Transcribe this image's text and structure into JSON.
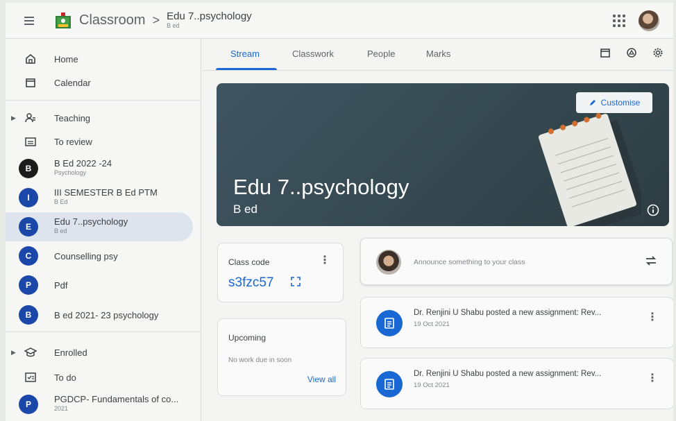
{
  "topbar": {
    "app_title": "Classroom",
    "crumb_title": "Edu 7..psychology",
    "crumb_sub": "B ed"
  },
  "sidebar": {
    "home": "Home",
    "calendar": "Calendar",
    "teaching": "Teaching",
    "to_review": "To review",
    "classes": [
      {
        "letter": "B",
        "label": "B Ed 2022 -24",
        "sub": "Psychology",
        "color": "#1c1c1c"
      },
      {
        "letter": "I",
        "label": "III SEMESTER B Ed PTM",
        "sub": "B Ed",
        "color": "#1a47a8"
      },
      {
        "letter": "E",
        "label": "Edu 7..psychology",
        "sub": "B ed",
        "color": "#1a47a8"
      },
      {
        "letter": "C",
        "label": "Counselling psy",
        "sub": "",
        "color": "#1a47a8"
      },
      {
        "letter": "P",
        "label": "Pdf",
        "sub": "",
        "color": "#1a47a8"
      },
      {
        "letter": "B",
        "label": "B ed 2021- 23 psychology",
        "sub": "",
        "color": "#1a47a8"
      }
    ],
    "enrolled": "Enrolled",
    "to_do": "To do",
    "enrolled_class": {
      "letter": "P",
      "label": "PGDCP- Fundamentals of co...",
      "sub": "2021",
      "color": "#1a47a8"
    }
  },
  "tabs": {
    "stream": "Stream",
    "classwork": "Classwork",
    "people": "People",
    "marks": "Marks"
  },
  "banner": {
    "title": "Edu 7..psychology",
    "subtitle": "B ed",
    "customise": "Customise"
  },
  "class_code": {
    "title": "Class code",
    "code": "s3fzc57"
  },
  "upcoming": {
    "title": "Upcoming",
    "empty": "No work due in soon",
    "view_all": "View all"
  },
  "announce": {
    "placeholder": "Announce something to your class"
  },
  "posts": [
    {
      "text": "Dr. Renjini U Shabu posted a new assignment: Rev...",
      "date": "19 Oct 2021"
    },
    {
      "text": "Dr. Renjini U Shabu posted a new assignment: Rev...",
      "date": "19 Oct 2021"
    }
  ]
}
